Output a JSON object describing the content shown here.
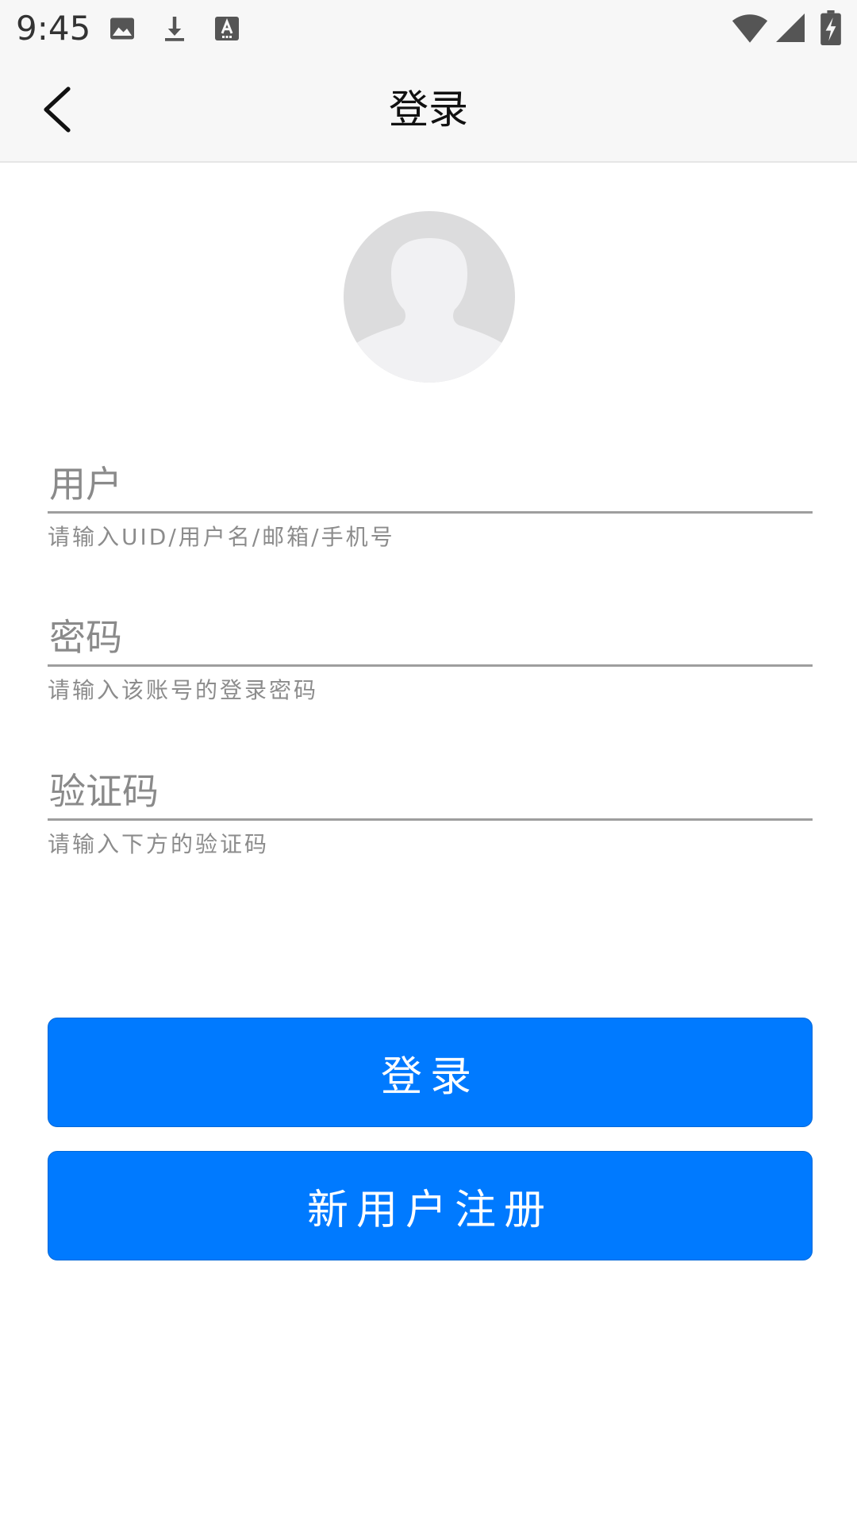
{
  "status_bar": {
    "time": "9:45",
    "icons": [
      "image-icon",
      "download-icon",
      "text-a-icon",
      "wifi-icon",
      "signal-icon",
      "battery-charging-icon"
    ]
  },
  "app_bar": {
    "title": "登录",
    "back_icon": "chevron-left-icon"
  },
  "avatar": {
    "icon": "user-placeholder-icon"
  },
  "form": {
    "username": {
      "label": "用户",
      "hint": "请输入UID/用户名/邮箱/手机号"
    },
    "password": {
      "label": "密码",
      "hint": "请输入该账号的登录密码"
    },
    "captcha": {
      "label": "验证码",
      "hint": "请输入下方的验证码"
    }
  },
  "buttons": {
    "login": "登录",
    "register": "新用户注册"
  },
  "colors": {
    "primary": "#007aff",
    "bar_background": "#f7f7f7",
    "avatar_background": "#dcdcdd"
  }
}
